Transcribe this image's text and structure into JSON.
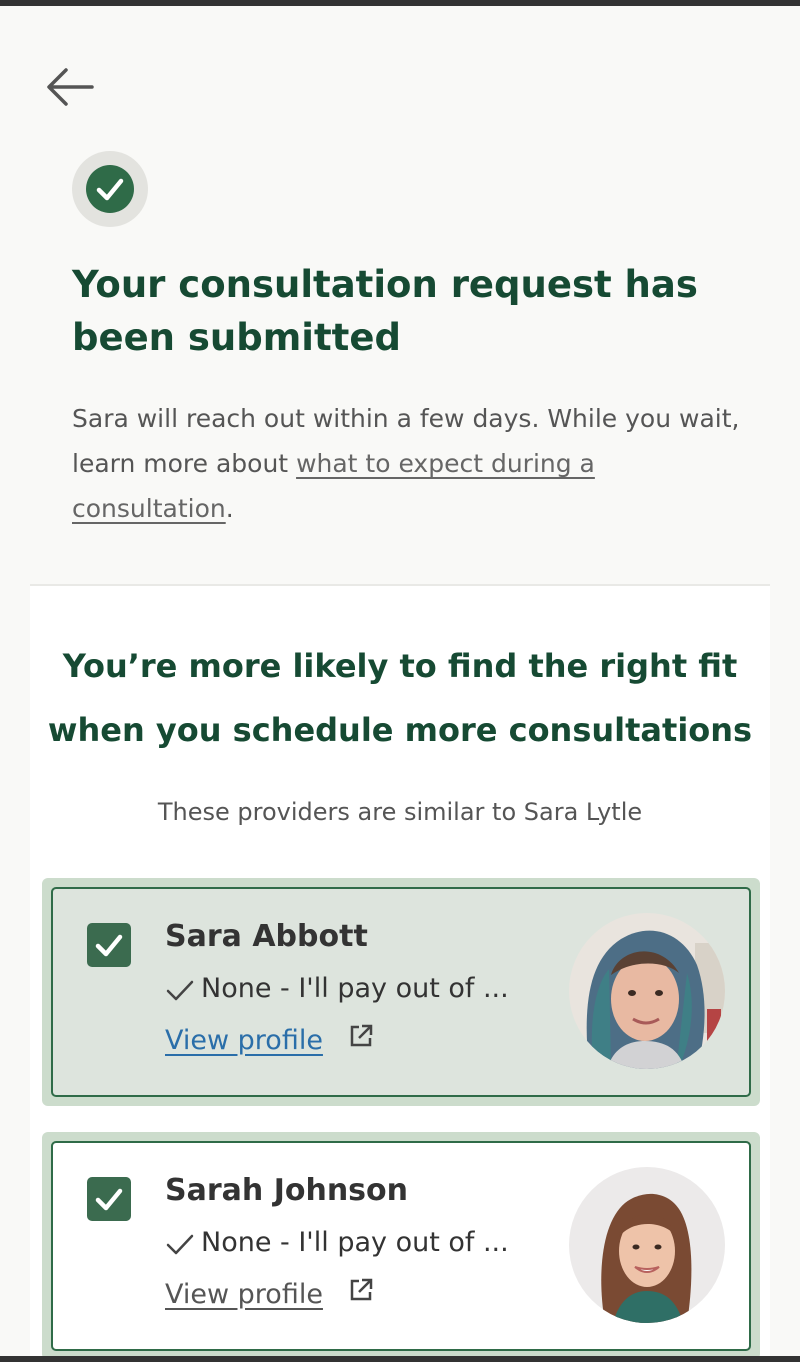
{
  "header": {
    "back_icon": "arrow-left-icon"
  },
  "success": {
    "icon": "check-circle-icon",
    "color": "#2f6b48"
  },
  "headline": "Your consultation request has been submitted",
  "subtext": {
    "prefix": "Sara will reach out within a few days. While you wait, learn more about ",
    "link": "what to expect during a consultation",
    "suffix": "."
  },
  "recommendations": {
    "title": "You’re more likely to find the right fit when you schedule more consultations",
    "subtitle": "These providers are similar to Sara Lytle",
    "providers": [
      {
        "name": "Sara Abbott",
        "payment": "None - I'll pay out of ...",
        "link": "View profile",
        "checked": true
      },
      {
        "name": "Sarah Johnson",
        "payment": "None - I'll pay out of ...",
        "link": "View profile",
        "checked": true
      }
    ]
  },
  "colors": {
    "brand_green": "#164a33",
    "accent_green": "#2f6b48",
    "link_blue": "#2a6ea9"
  }
}
